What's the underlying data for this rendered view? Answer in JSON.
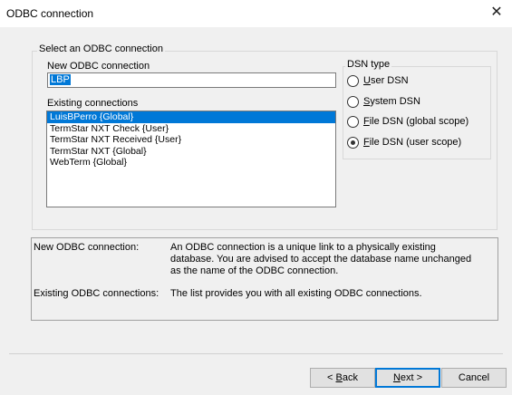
{
  "window": {
    "title": "ODBC connection",
    "close_glyph": "✕"
  },
  "group": {
    "caption": "Select an ODBC connection"
  },
  "new_connection": {
    "label": "New ODBC connection",
    "value": "LBP"
  },
  "existing": {
    "label": "Existing connections",
    "items": [
      "LuisBPerro {Global}",
      "TermStar NXT Check {User}",
      "TermStar NXT Received {User}",
      "TermStar NXT {Global}",
      "WebTerm {Global}"
    ],
    "selected_index": 0
  },
  "dsn": {
    "caption": "DSN type",
    "options": [
      {
        "key": "U",
        "rest": "ser DSN",
        "checked": false
      },
      {
        "key": "S",
        "rest": "ystem DSN",
        "checked": false
      },
      {
        "key": "F",
        "rest": "ile DSN (global scope)",
        "checked": false
      },
      {
        "key": "F",
        "rest": "ile DSN (user scope)",
        "checked": true
      }
    ]
  },
  "info": {
    "rows": [
      {
        "term": "New ODBC connection:",
        "desc": "An ODBC connection is a unique link to a physically existing database. You are advised to accept the database name unchanged as the name of the ODBC connection."
      },
      {
        "term": "Existing ODBC connections:",
        "desc": "The list provides you with all existing ODBC connections."
      }
    ]
  },
  "buttons": {
    "back": {
      "prefix": "< ",
      "key": "B",
      "rest": "ack"
    },
    "next": {
      "key": "N",
      "rest": "ext >"
    },
    "cancel": "Cancel"
  },
  "colors": {
    "selection": "#0078d7",
    "dialog_bg": "#f0f0f0"
  }
}
